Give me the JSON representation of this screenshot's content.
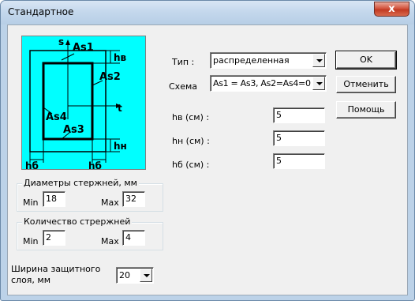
{
  "window": {
    "title": "Стандартное",
    "close_glyph": "x"
  },
  "diagram": {
    "labels": {
      "s": "s",
      "t": "t",
      "as1": "As1",
      "as2": "As2",
      "as3": "As3",
      "as4": "As4",
      "hv": "hв",
      "hn": "hн",
      "hb_left": "hб",
      "hb_right": "hб"
    },
    "colors": {
      "background": "#00ffff",
      "lines": "#000000"
    }
  },
  "diameters": {
    "title": "Диаметры стержней, мм",
    "min_label": "Min",
    "min_value": "18",
    "max_label": "Max",
    "max_value": "32"
  },
  "count": {
    "title": "Количество стрержней",
    "min_label": "Min",
    "min_value": "2",
    "max_label": "Max",
    "max_value": "4"
  },
  "cover": {
    "label_line1": "Ширина защитного",
    "label_line2": "слоя, мм",
    "value": "20"
  },
  "form": {
    "type_label": "Тип :",
    "type_value": "распределенная",
    "scheme_label": "Схема",
    "scheme_value": "As1 = As3, As2=As4=0",
    "hv_label": "hв (см) :",
    "hv_value": "5",
    "hn_label": "hн (см) :",
    "hn_value": "5",
    "hb_label": "hб (см) :",
    "hb_value": "5"
  },
  "buttons": {
    "ok": "OK",
    "cancel": "Отменить",
    "help": "Помощь"
  }
}
